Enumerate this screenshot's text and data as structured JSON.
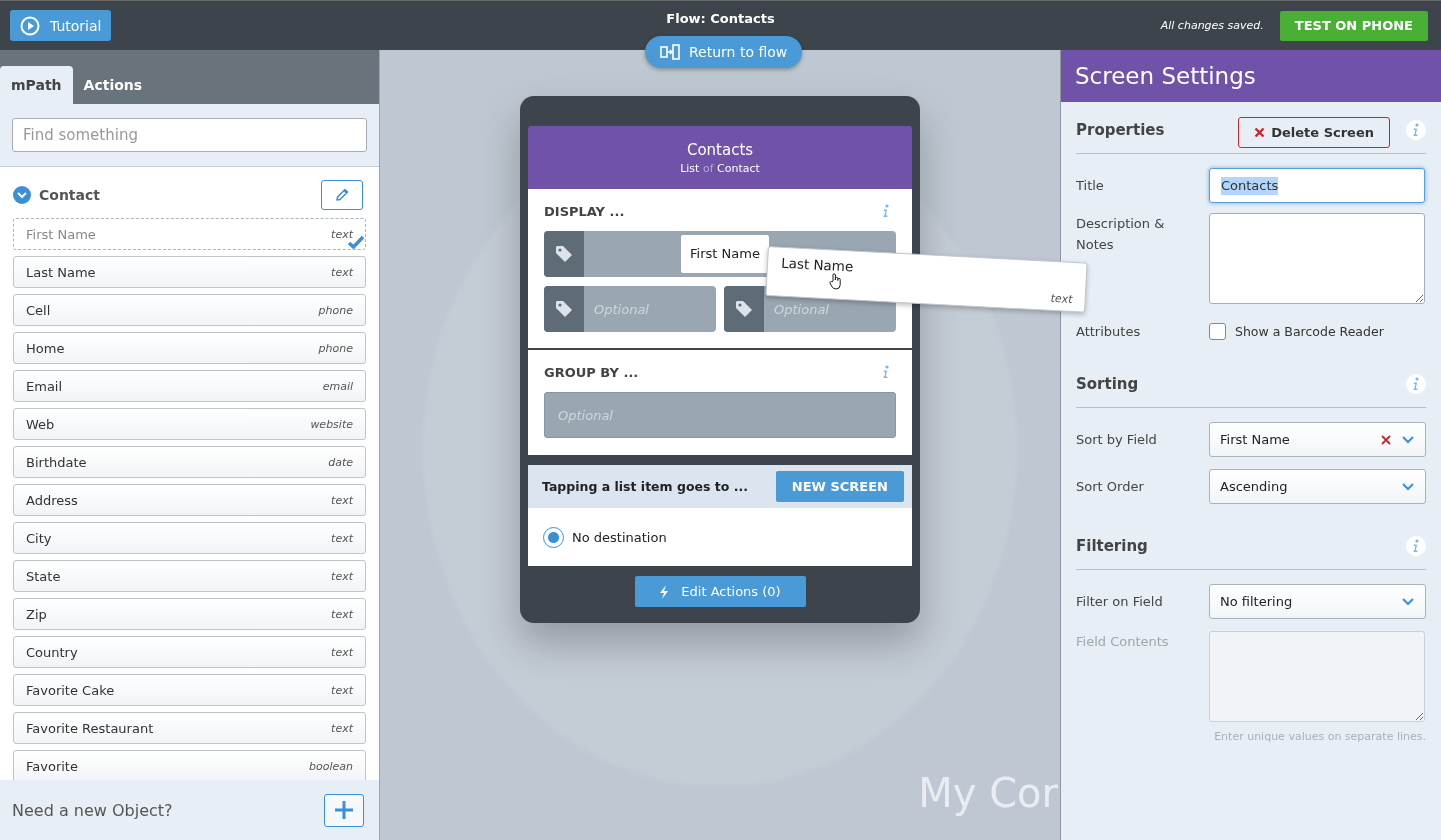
{
  "top_bar": {
    "tutorial_button": "Tutorial",
    "title": "Flow: Contacts",
    "save_status": "All changes saved.",
    "test_button": "TEST ON PHONE"
  },
  "left_panel": {
    "tabs": [
      {
        "label": "mPath",
        "selected": true
      },
      {
        "label": "Actions",
        "selected": false
      }
    ],
    "search": {
      "placeholder": "Find something"
    },
    "object": {
      "name": "Contact",
      "expanded": true,
      "fields": [
        {
          "name": "First Name",
          "type": "text",
          "dragging": true
        },
        {
          "name": "Last Name",
          "type": "text",
          "dragging": false
        },
        {
          "name": "Cell",
          "type": "phone",
          "dragging": false
        },
        {
          "name": "Home",
          "type": "phone",
          "dragging": false
        },
        {
          "name": "Email",
          "type": "email",
          "dragging": false
        },
        {
          "name": "Web",
          "type": "website",
          "dragging": false
        },
        {
          "name": "Birthdate",
          "type": "date",
          "dragging": false
        },
        {
          "name": "Address",
          "type": "text",
          "dragging": false
        },
        {
          "name": "City",
          "type": "text",
          "dragging": false
        },
        {
          "name": "State",
          "type": "text",
          "dragging": false
        },
        {
          "name": "Zip",
          "type": "text",
          "dragging": false
        },
        {
          "name": "Country",
          "type": "text",
          "dragging": false
        },
        {
          "name": "Favorite Cake",
          "type": "text",
          "dragging": false
        },
        {
          "name": "Favorite Restaurant",
          "type": "text",
          "dragging": false
        },
        {
          "name": "Favorite",
          "type": "boolean",
          "dragging": false
        }
      ]
    },
    "footer": {
      "label": "Need a new Object?"
    }
  },
  "canvas": {
    "return_button": "Return to flow",
    "background_text": "My Cor",
    "phone": {
      "title": "Contacts",
      "subtitle": {
        "kind": "List",
        "connector": "of",
        "object": "Contact"
      },
      "display": {
        "heading": "DISPLAY ...",
        "slots": [
          {
            "value": "First Name"
          },
          {
            "placeholder": "Optional"
          },
          {
            "placeholder": "Optional"
          }
        ]
      },
      "group_by": {
        "heading": "GROUP BY ...",
        "placeholder": "Optional"
      },
      "tap": {
        "label": "Tapping a list item goes to ...",
        "button": "NEW SCREEN",
        "options": [
          {
            "label": "No destination",
            "selected": true
          }
        ]
      },
      "edit_actions": "Edit Actions (0)"
    },
    "drag_card": {
      "name": "Last Name",
      "type": "text"
    }
  },
  "screen_settings": {
    "title": "Screen Settings",
    "properties": {
      "heading": "Properties",
      "delete_button": "Delete Screen",
      "title_label": "Title",
      "title_value": "Contacts",
      "title_text_selected": true,
      "description_label": "Description & Notes",
      "attributes_label": "Attributes",
      "barcode": {
        "label": "Show a Barcode Reader",
        "checked": false
      }
    },
    "sorting": {
      "heading": "Sorting",
      "rows": [
        {
          "label": "Sort by Field",
          "value": "First Name",
          "clearable": true
        },
        {
          "label": "Sort Order",
          "value": "Ascending",
          "clearable": false
        }
      ]
    },
    "filtering": {
      "heading": "Filtering",
      "rows": [
        {
          "label": "Filter on Field",
          "value": "No filtering",
          "clearable": false
        }
      ],
      "contents": {
        "label": "Field Contents",
        "disabled": true,
        "hint": "Enter unique values on separate lines."
      }
    }
  }
}
